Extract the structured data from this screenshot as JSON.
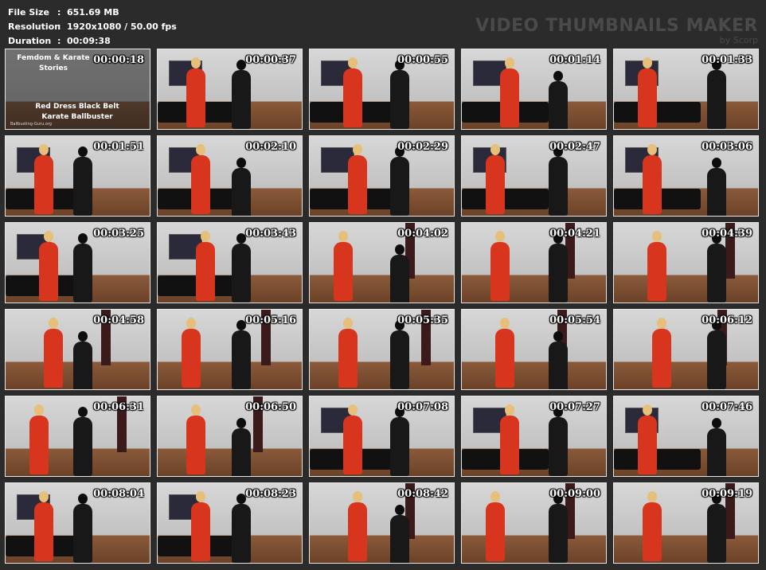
{
  "info": {
    "file_size_label": "File Size",
    "file_size_value": "651.69 MB",
    "resolution_label": "Resolution",
    "resolution_value": "1920x1080 / 50.00 fps",
    "duration_label": "Duration",
    "duration_value": "00:09:38"
  },
  "brand": {
    "title": "VIDEO THUMBNAILS MAKER",
    "subtitle": "by Scorp"
  },
  "title_card": {
    "top_line1": "Femdom & Karate",
    "top_line2": "Stories",
    "bottom_line1": "Red Dress Black Belt",
    "bottom_line2": "Karate Ballbuster",
    "watermark": "Ballbusting-Guru.org"
  },
  "thumbnails": [
    "00:00:18",
    "00:00:37",
    "00:00:55",
    "00:01:14",
    "00:01:33",
    "00:01:51",
    "00:02:10",
    "00:02:29",
    "00:02:47",
    "00:03:06",
    "00:03:25",
    "00:03:43",
    "00:04:02",
    "00:04:21",
    "00:04:39",
    "00:04:58",
    "00:05:16",
    "00:05:35",
    "00:05:54",
    "00:06:12",
    "00:06:31",
    "00:06:50",
    "00:07:08",
    "00:07:27",
    "00:07:46",
    "00:08:04",
    "00:08:23",
    "00:08:42",
    "00:09:00",
    "00:09:19"
  ]
}
